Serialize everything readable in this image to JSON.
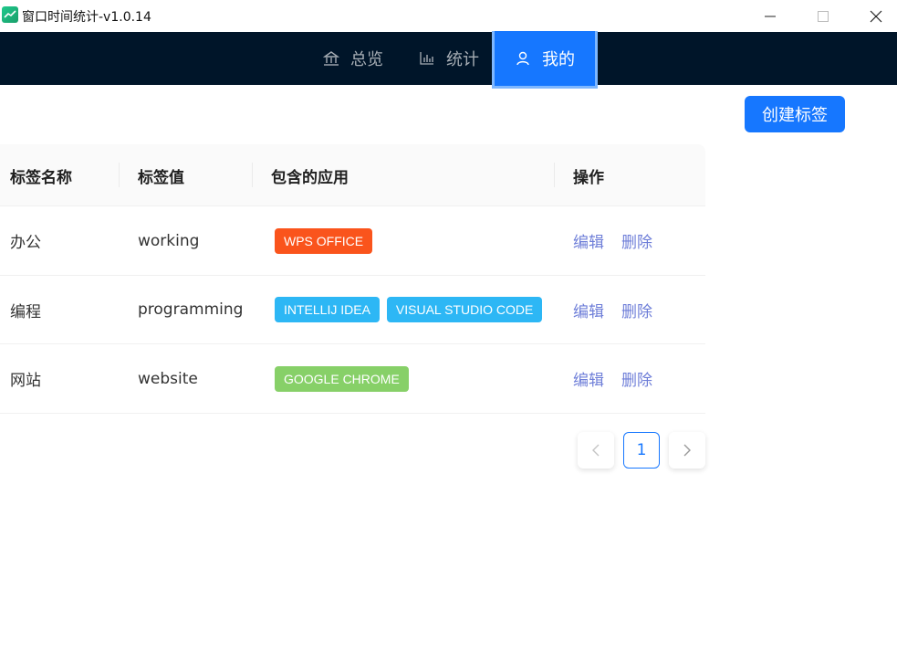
{
  "window": {
    "title": "窗口时间统计-v1.0.14"
  },
  "nav": {
    "items": [
      {
        "label": "总览",
        "icon": "bank-icon"
      },
      {
        "label": "统计",
        "icon": "bar-chart-icon"
      },
      {
        "label": "我的",
        "icon": "user-icon",
        "active": true
      }
    ]
  },
  "toolbar": {
    "create_label": "创建标签"
  },
  "table": {
    "columns": [
      "标签名称",
      "标签值",
      "包含的应用",
      "操作"
    ],
    "rows": [
      {
        "name": "办公",
        "value": "working",
        "apps": [
          {
            "label": "WPS OFFICE",
            "color": "#fa541c"
          }
        ],
        "edit": "编辑",
        "delete": "删除"
      },
      {
        "name": "编程",
        "value": "programming",
        "apps": [
          {
            "label": "INTELLIJ IDEA",
            "color": "#2db7f5"
          },
          {
            "label": "VISUAL STUDIO CODE",
            "color": "#2db7f5"
          }
        ],
        "edit": "编辑",
        "delete": "删除"
      },
      {
        "name": "网站",
        "value": "website",
        "apps": [
          {
            "label": "GOOGLE CHROME",
            "color": "#87d068"
          }
        ],
        "edit": "编辑",
        "delete": "删除"
      }
    ]
  },
  "pagination": {
    "current_page": "1"
  },
  "colors": {
    "nav_bg": "#001529",
    "primary": "#1677ff",
    "link": "#6e7ed8"
  }
}
